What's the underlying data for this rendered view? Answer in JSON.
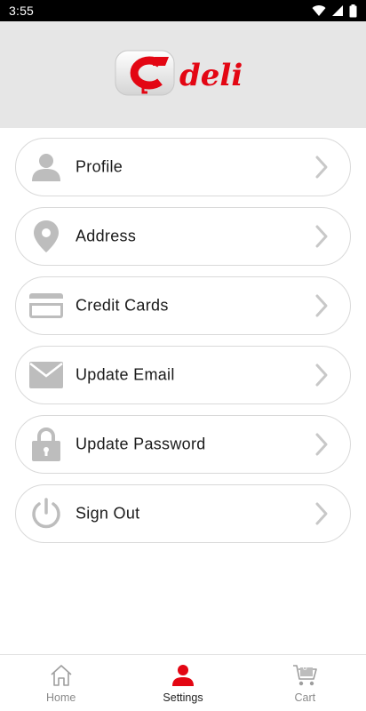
{
  "status_bar": {
    "time": "3:55",
    "icons": [
      "wifi-icon",
      "signal-icon",
      "battery-icon"
    ]
  },
  "header": {
    "logo": {
      "symbol": "Ç",
      "text": "deli",
      "brand_color": "#e30613"
    }
  },
  "menu": {
    "items": [
      {
        "label": "Profile",
        "icon": "person-icon"
      },
      {
        "label": "Address",
        "icon": "location-pin-icon"
      },
      {
        "label": "Credit Cards",
        "icon": "credit-card-icon"
      },
      {
        "label": "Update Email",
        "icon": "envelope-icon"
      },
      {
        "label": "Update Password",
        "icon": "lock-icon"
      },
      {
        "label": "Sign Out",
        "icon": "power-icon"
      }
    ],
    "chevron_icon": "chevron-right-icon"
  },
  "bottom_nav": {
    "items": [
      {
        "label": "Home",
        "icon": "home-icon",
        "active": false
      },
      {
        "label": "Settings",
        "icon": "person-icon",
        "active": true
      },
      {
        "label": "Cart",
        "icon": "cart-icon",
        "active": false,
        "badge": "0"
      }
    ]
  },
  "colors": {
    "accent": "#e30613",
    "icon_gray": "#bdbdbd",
    "header_bg": "#e6e6e6",
    "border": "#d9d9d9"
  }
}
